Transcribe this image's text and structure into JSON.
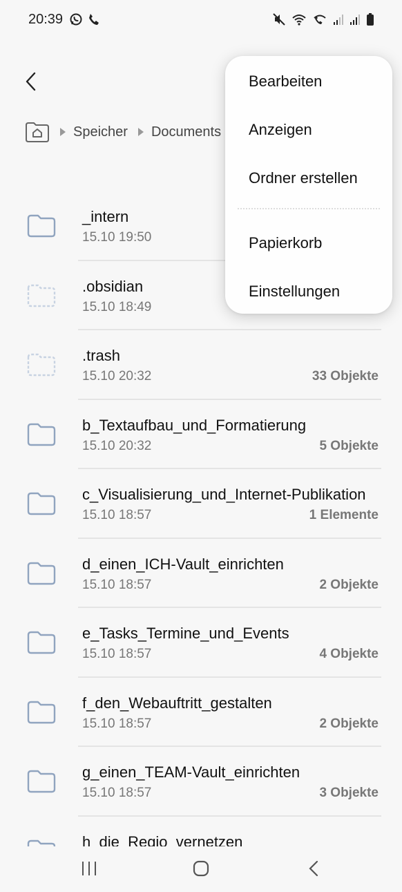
{
  "status_bar": {
    "time": "20:39",
    "app_icons": [
      "whatsapp-icon",
      "phone-icon"
    ],
    "right_icons": [
      "mute-icon",
      "wifi-icon",
      "wifi-calling-icon",
      "signal-icon",
      "signal-icon",
      "battery-icon"
    ]
  },
  "breadcrumb": {
    "items": [
      "Speicher",
      "Documents"
    ]
  },
  "files": [
    {
      "name": "_intern",
      "date": "15.10 19:50",
      "count": "",
      "icon": "folder-icon",
      "dashed": false
    },
    {
      "name": ".obsidian",
      "date": "15.10 18:49",
      "count": "",
      "icon": "hidden-folder-icon",
      "dashed": true
    },
    {
      "name": ".trash",
      "date": "15.10 20:32",
      "count": "33 Objekte",
      "icon": "hidden-folder-icon",
      "dashed": true
    },
    {
      "name": "b_Textaufbau_und_Formatierung",
      "date": "15.10 20:32",
      "count": "5 Objekte",
      "icon": "folder-icon",
      "dashed": false
    },
    {
      "name": "c_Visualisierung_und_Internet-Publikation",
      "date": "15.10 18:57",
      "count": "1 Elemente",
      "icon": "folder-icon",
      "dashed": false
    },
    {
      "name": "d_einen_ICH-Vault_einrichten",
      "date": "15.10 18:57",
      "count": "2 Objekte",
      "icon": "folder-icon",
      "dashed": false
    },
    {
      "name": "e_Tasks_Termine_und_Events",
      "date": "15.10 18:57",
      "count": "4 Objekte",
      "icon": "folder-icon",
      "dashed": false
    },
    {
      "name": "f_den_Webauftritt_gestalten",
      "date": "15.10 18:57",
      "count": "2 Objekte",
      "icon": "folder-icon",
      "dashed": false
    },
    {
      "name": "g_einen_TEAM-Vault_einrichten",
      "date": "15.10 18:57",
      "count": "3 Objekte",
      "icon": "folder-icon",
      "dashed": false
    },
    {
      "name": "h_die_Regio_vernetzen",
      "date": "",
      "count": "",
      "icon": "folder-icon",
      "dashed": false
    }
  ],
  "menu": {
    "items": [
      "Bearbeiten",
      "Anzeigen",
      "Ordner erstellen",
      "Papierkorb",
      "Einstellungen"
    ]
  },
  "nav_bar": {
    "icons": [
      "recents-icon",
      "home-icon",
      "back-icon"
    ]
  },
  "colors": {
    "folder_stroke": "#90a4bf",
    "hidden_folder_stroke": "#c8d3e2",
    "background": "#f7f7f7",
    "menu_bg": "#fefefe"
  }
}
